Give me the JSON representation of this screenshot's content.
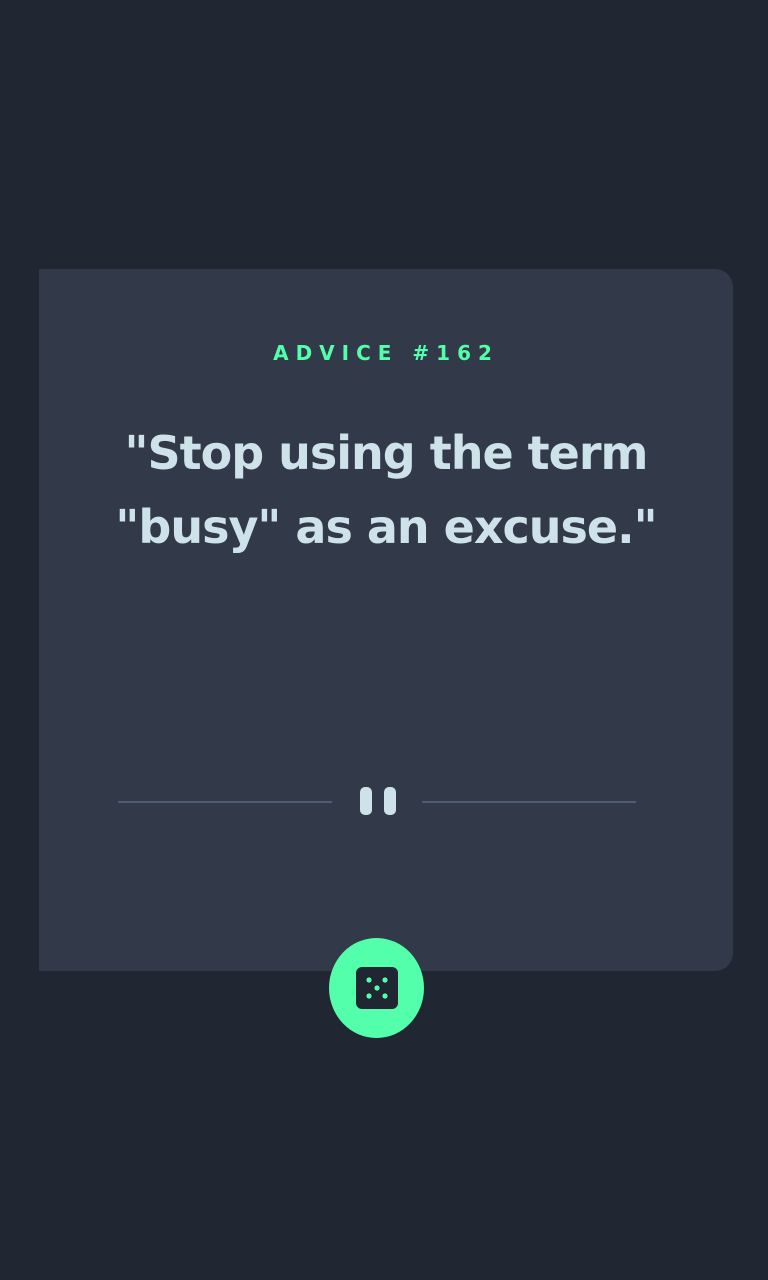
{
  "advice": {
    "label": "ADVICE #162",
    "quote": "\"Stop using the term \"busy\" as an excuse.\""
  },
  "icons": {
    "divider": "pause-icon",
    "generate": "dice-icon"
  },
  "colors": {
    "background": "#202632",
    "card": "#323a49",
    "accent": "#53ffaa",
    "text": "#cee3e9",
    "divider": "#4f5d74"
  }
}
